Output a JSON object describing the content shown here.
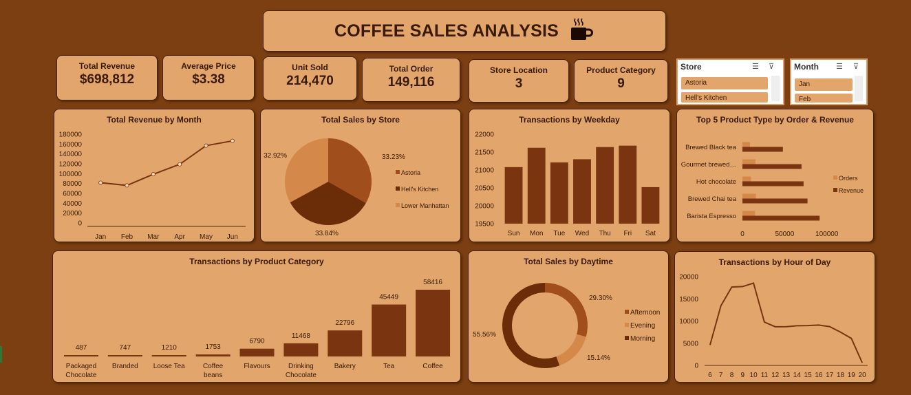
{
  "title": "COFFEE SALES ANALYSIS",
  "kpis": [
    {
      "label": "Total Revenue",
      "value": "$698,812"
    },
    {
      "label": "Average Price",
      "value": "$3.38"
    },
    {
      "label": "Unit Sold",
      "value": "214,470"
    },
    {
      "label": "Total Order",
      "value": "149,116"
    },
    {
      "label": "Store Location",
      "value": "3"
    },
    {
      "label": "Product Category",
      "value": "9"
    }
  ],
  "slicers": {
    "store": {
      "title": "Store",
      "items": [
        "Astoria",
        "Hell's Kitchen"
      ]
    },
    "month": {
      "title": "Month",
      "items": [
        "Jan",
        "Feb"
      ]
    }
  },
  "colors": {
    "background": "#7b3f12",
    "card": "#e2a56b",
    "bar": "#7a3510",
    "line": "#7a3510",
    "dark": "#6b2c08",
    "mid": "#a04e1c",
    "light": "#d4884a"
  },
  "chart_data": [
    {
      "type": "line",
      "title": "Total Revenue by Month",
      "categories": [
        "Jan",
        "Feb",
        "Mar",
        "Apr",
        "May",
        "Jun"
      ],
      "values": [
        81678,
        76145,
        98834,
        118941,
        156728,
        166486
      ],
      "ylim": [
        0,
        180000
      ],
      "yticks": [
        "180000",
        "160000",
        "140000",
        "120000",
        "100000",
        "80000",
        "60000",
        "40000",
        "20000",
        "0"
      ],
      "grid": false
    },
    {
      "type": "pie",
      "title": "Total Sales by Store",
      "series": [
        {
          "name": "Astoria",
          "value": 33.23,
          "label": "33.23%",
          "color": "#a04e1c"
        },
        {
          "name": "Hell's Kitchen",
          "value": 33.84,
          "label": "33.84%",
          "color": "#6b2c08"
        },
        {
          "name": "Lower Manhattan",
          "value": 32.92,
          "label": "32.92%",
          "color": "#d4884a"
        }
      ],
      "legend": "right"
    },
    {
      "type": "bar",
      "title": "Transactions by Weekday",
      "categories": [
        "Sun",
        "Mon",
        "Tue",
        "Wed",
        "Thu",
        "Fri",
        "Sat"
      ],
      "values": [
        21080,
        21620,
        21210,
        21300,
        21640,
        21680,
        20520
      ],
      "ylim": [
        19500,
        22000
      ],
      "yticks": [
        "22000",
        "21500",
        "21000",
        "20500",
        "20000",
        "19500"
      ]
    },
    {
      "type": "bar",
      "title": "Top 5  Product Type by Order & Revenue",
      "categories": [
        "Brewed Black tea",
        "Gourmet brewed…",
        "Hot chocolate",
        "Brewed Chai tea",
        "Barista Espresso"
      ],
      "series": [
        {
          "name": "Orders",
          "values": [
            8900,
            15400,
            10100,
            15900,
            15000
          ],
          "color": "#d4884a"
        },
        {
          "name": "Revenue",
          "values": [
            47900,
            70000,
            72400,
            77100,
            91400
          ],
          "color": "#7a3510"
        }
      ],
      "xticks": [
        "0",
        "50000",
        "100000"
      ],
      "xlim": [
        0,
        110000
      ],
      "legend": "right"
    },
    {
      "type": "bar",
      "title": "Transactions by Product Category",
      "categories": [
        "Packaged Chocolate",
        "Branded",
        "Loose Tea",
        "Coffee beans",
        "Flavours",
        "Drinking Chocolate",
        "Bakery",
        "Tea",
        "Coffee"
      ],
      "values": [
        487,
        747,
        1210,
        1753,
        6790,
        11468,
        22796,
        45449,
        58416
      ],
      "value_labels": [
        "487",
        "747",
        "1210",
        "1753",
        "6790",
        "11468",
        "22796",
        "45449",
        "58416"
      ]
    },
    {
      "type": "pie",
      "title": "Total Sales by Daytime",
      "series": [
        {
          "name": "Afternoon",
          "value": 29.3,
          "label": "29.30%",
          "color": "#a04e1c"
        },
        {
          "name": "Evening",
          "value": 15.14,
          "label": "15.14%",
          "color": "#d4884a"
        },
        {
          "name": "Morning",
          "value": 55.56,
          "label": "55.56%",
          "color": "#6b2c08"
        }
      ],
      "legend": "right"
    },
    {
      "type": "line",
      "title": "Transactions by Hour of Day",
      "categories": [
        "6",
        "7",
        "8",
        "9",
        "10",
        "11",
        "12",
        "13",
        "14",
        "15",
        "16",
        "17",
        "18",
        "19",
        "20"
      ],
      "values": [
        4594,
        13428,
        17654,
        17764,
        18545,
        9766,
        8708,
        8714,
        8933,
        8979,
        9093,
        8745,
        7498,
        6092,
        603
      ],
      "ylim": [
        0,
        20000
      ],
      "yticks": [
        "20000",
        "15000",
        "10000",
        "5000",
        "0"
      ]
    }
  ]
}
